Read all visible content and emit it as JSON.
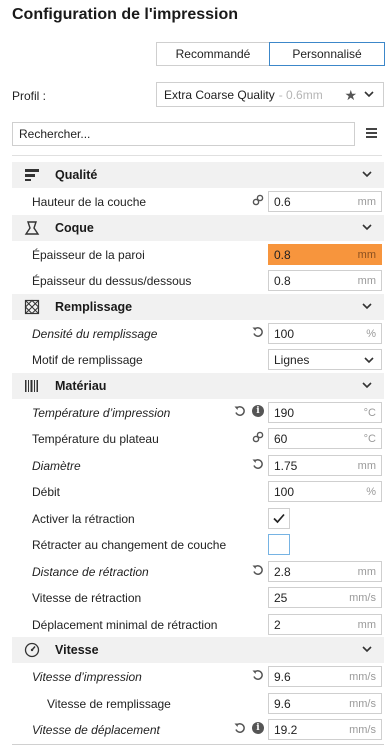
{
  "title": "Configuration de l'impression",
  "modes": [
    "Recommandé",
    "Personnalisé"
  ],
  "profile": {
    "label": "Profil :",
    "name": "Extra Coarse Quality",
    "detail": "- 0.6mm"
  },
  "search": {
    "placeholder": "Rechercher..."
  },
  "categories": {
    "qualite": "Qualité",
    "coque": "Coque",
    "remplissage": "Remplissage",
    "materiau": "Matériau",
    "vitesse": "Vitesse"
  },
  "settings": {
    "hauteur_couche": {
      "label": "Hauteur de la couche",
      "value": "0.6",
      "unit": "mm"
    },
    "epaisseur_paroi": {
      "label": "Épaisseur de la paroi",
      "value": "0.8",
      "unit": "mm"
    },
    "epaisseur_dessus": {
      "label": "Épaisseur du dessus/dessous",
      "value": "0.8",
      "unit": "mm"
    },
    "densite_remplissage": {
      "label": "Densité du remplissage",
      "value": "100",
      "unit": "%"
    },
    "motif_remplissage": {
      "label": "Motif de remplissage",
      "value": "Lignes"
    },
    "temp_impression": {
      "label": "Température d’impression",
      "value": "190",
      "unit": "°C"
    },
    "temp_plateau": {
      "label": "Température du plateau",
      "value": "60",
      "unit": "°C"
    },
    "diametre": {
      "label": "Diamètre",
      "value": "1.75",
      "unit": "mm"
    },
    "debit": {
      "label": "Débit",
      "value": "100",
      "unit": "%"
    },
    "activer_retraction": {
      "label": "Activer la rétraction",
      "checked": true
    },
    "retracter_couche": {
      "label": "Rétracter au changement de couche",
      "checked": false
    },
    "distance_retraction": {
      "label": "Distance de rétraction",
      "value": "2.8",
      "unit": "mm"
    },
    "vitesse_retraction": {
      "label": "Vitesse de rétraction",
      "value": "25",
      "unit": "mm/s"
    },
    "deplacement_min": {
      "label": "Déplacement minimal de rétraction",
      "value": "2",
      "unit": "mm"
    },
    "vitesse_impression": {
      "label": "Vitesse d’impression",
      "value": "9.6",
      "unit": "mm/s"
    },
    "vitesse_remplissage": {
      "label": "Vitesse de remplissage",
      "value": "9.6",
      "unit": "mm/s"
    },
    "vitesse_deplacement": {
      "label": "Vitesse de déplacement",
      "value": "19.2",
      "unit": "mm/s"
    }
  },
  "colors": {
    "accent": "#3c87c9",
    "highlight": "#f7953d",
    "category_bg": "#f1f1f1"
  },
  "icons": [
    "chevron-down-icon",
    "star-icon",
    "menu-icon",
    "link-icon",
    "reset-icon",
    "info-icon",
    "check-icon"
  ]
}
